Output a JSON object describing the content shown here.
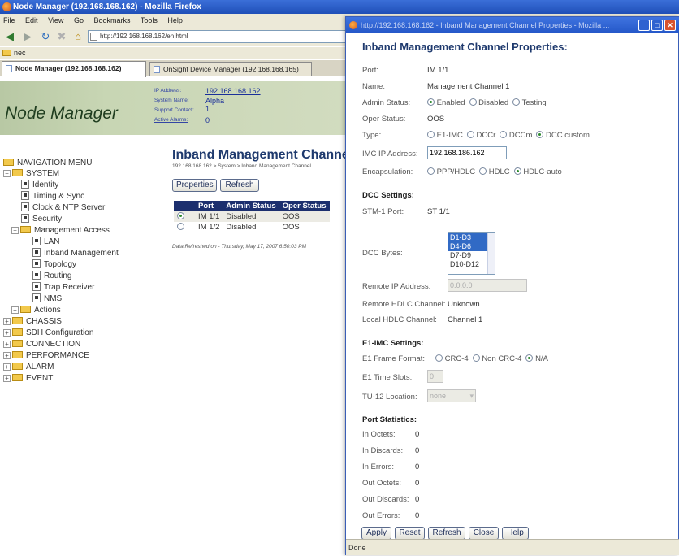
{
  "main_window": {
    "title": "Node Manager (192.168.168.162) - Mozilla Firefox",
    "menu": [
      "File",
      "Edit",
      "View",
      "Go",
      "Bookmarks",
      "Tools",
      "Help"
    ],
    "url": "http://192.168.168.162/en.html",
    "bookmark_folder": "nec",
    "tabs": [
      {
        "label": "Node Manager (192.168.168.162)",
        "active": true
      },
      {
        "label": "OnSight Device Manager (192.168.168.165)",
        "active": false
      }
    ]
  },
  "header": {
    "logo": "Node Manager",
    "ip_label": "IP Address:",
    "ip_value": "192.168.168.162",
    "sysname_label": "System Name:",
    "sysname_value": "Alpha 1",
    "contact_label": "Support Contact:",
    "contact_value": "",
    "alarms_label": "Active Alarms:",
    "alarms_value": "0"
  },
  "sidebar": {
    "nav_menu": "NAVIGATION MENU",
    "system": "SYSTEM",
    "identity": "Identity",
    "timing": "Timing & Sync",
    "clock": "Clock & NTP Server",
    "security": "Security",
    "mgmt_access": "Management Access",
    "lan": "LAN",
    "inband": "Inband Management",
    "topology": "Topology",
    "routing": "Routing",
    "trap": "Trap Receiver",
    "nms": "NMS",
    "actions": "Actions",
    "chassis": "CHASSIS",
    "sdh": "SDH Configuration",
    "connection": "CONNECTION",
    "performance": "PERFORMANCE",
    "alarm": "ALARM",
    "event": "EVENT"
  },
  "content": {
    "title": "Inband Management Channel",
    "breadcrumb": "192.168.168.162 > System > Inband Management Channel",
    "properties_btn": "Properties",
    "refresh_btn": "Refresh",
    "table_headers": [
      "Port",
      "Admin Status",
      "Oper Status"
    ],
    "rows": [
      {
        "port": "IM 1/1",
        "admin": "Disabled",
        "oper": "OOS",
        "selected": true
      },
      {
        "port": "IM 1/2",
        "admin": "Disabled",
        "oper": "OOS",
        "selected": false
      }
    ],
    "refreshed": "Data Refreshed on - Thursday, May 17, 2007 6:50:03 PM"
  },
  "popup": {
    "title": "http://192.168.168.162 - Inband Management Channel Properties - Mozilla ...",
    "heading": "Inband Management Channel Properties:",
    "port_label": "Port:",
    "port_value": "IM 1/1",
    "name_label": "Name:",
    "name_value": "Management Channel 1",
    "admin_label": "Admin Status:",
    "admin_options": [
      "Enabled",
      "Disabled",
      "Testing"
    ],
    "admin_selected": "Enabled",
    "oper_label": "Oper Status:",
    "oper_value": "OOS",
    "type_label": "Type:",
    "type_options": [
      "E1-IMC",
      "DCCr",
      "DCCm",
      "DCC custom"
    ],
    "type_selected": "DCC custom",
    "imc_ip_label": "IMC IP Address:",
    "imc_ip_value": "192.168.186.162",
    "encap_label": "Encapsulation:",
    "encap_options": [
      "PPP/HDLC",
      "HDLC",
      "HDLC-auto"
    ],
    "encap_selected": "HDLC-auto",
    "dcc_settings": "DCC Settings:",
    "stm_label": "STM-1 Port:",
    "stm_value": "ST 1/1",
    "dcc_bytes_label": "DCC Bytes:",
    "dcc_bytes": [
      "D1-D3",
      "D4-D6",
      "D7-D9",
      "D10-D12"
    ],
    "dcc_selected": [
      "D1-D3",
      "D4-D6"
    ],
    "remote_ip_label": "Remote IP Address:",
    "remote_ip_value": "0.0.0.0",
    "remote_hdlc_label": "Remote HDLC Channel:",
    "remote_hdlc_value": "Unknown",
    "local_hdlc_label": "Local HDLC Channel:",
    "local_hdlc_value": "Channel 1",
    "e1_settings": "E1-IMC Settings:",
    "e1_format_label": "E1 Frame Format:",
    "e1_format_options": [
      "CRC-4",
      "Non CRC-4",
      "N/A"
    ],
    "e1_format_selected": "N/A",
    "e1_slots_label": "E1 Time Slots:",
    "e1_slots_value": "0",
    "tu12_label": "TU-12 Location:",
    "tu12_value": "none",
    "port_stats": "Port Statistics:",
    "stats": [
      {
        "label": "In Octets:",
        "value": "0"
      },
      {
        "label": "In Discards:",
        "value": "0"
      },
      {
        "label": "In Errors:",
        "value": "0"
      },
      {
        "label": "Out Octets:",
        "value": "0"
      },
      {
        "label": "Out Discards:",
        "value": "0"
      },
      {
        "label": "Out Errors:",
        "value": "0"
      }
    ],
    "buttons": [
      "Apply",
      "Reset",
      "Refresh",
      "Close",
      "Help"
    ],
    "status": "Done"
  }
}
